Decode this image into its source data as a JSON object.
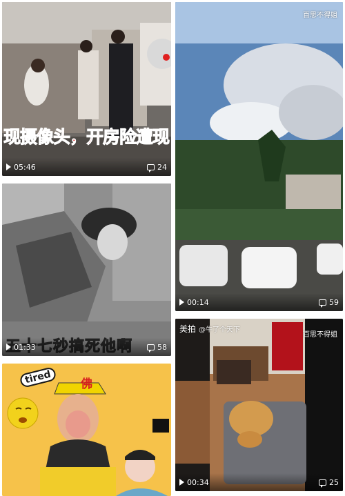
{
  "cards": [
    {
      "id": "card-1",
      "caption": "现摄像头，开房险遭现",
      "duration": "05:46",
      "comments": "24"
    },
    {
      "id": "card-2",
      "watermark_right": "百思不得姐",
      "duration": "00:14",
      "comments": "59"
    },
    {
      "id": "card-3",
      "caption": "五十七秒搞死他啊",
      "duration": "01:33",
      "comments": "58"
    },
    {
      "id": "card-4",
      "badge_tired": "tired",
      "badge_fo": "佛"
    },
    {
      "id": "card-5",
      "watermark_left": "美拍",
      "watermark_user": "@牛了个天下",
      "watermark_right": "百思不得姐",
      "duration": "00:34",
      "comments": "25"
    }
  ],
  "colors": {
    "caption_red": "#d8201e",
    "card4_bg": "#f6c24a",
    "text_white": "#ffffff"
  },
  "icons": [
    "play-icon",
    "comment-icon"
  ]
}
